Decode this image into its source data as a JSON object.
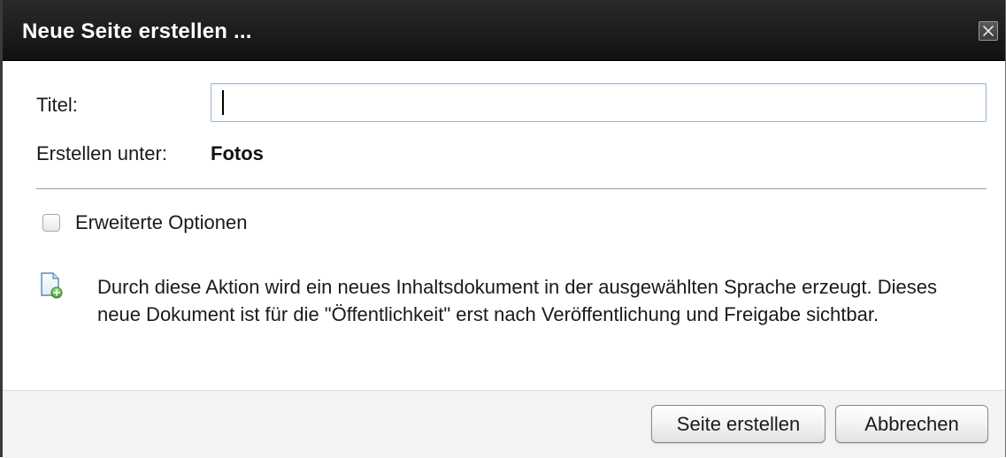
{
  "dialog": {
    "title": "Neue Seite erstellen ...",
    "close_icon": "close-icon"
  },
  "form": {
    "title_label": "Titel:",
    "title_value": "",
    "create_under_label": "Erstellen unter:",
    "create_under_value": "Fotos",
    "advanced_options_label": "Erweiterte Optionen",
    "advanced_options_checked": false
  },
  "info": {
    "icon": "new-document-icon",
    "text": "Durch diese Aktion wird ein neues Inhaltsdokument in der ausgewählten Sprache erzeugt. Dieses neue Dokument ist für die \"Öffentlichkeit\" erst nach Veröffentlichung und Freigabe sichtbar."
  },
  "buttons": {
    "create_label": "Seite erstellen",
    "cancel_label": "Abbrechen"
  },
  "colors": {
    "titlebar": "#1f1f1f",
    "input_border": "#9cb7d1",
    "footer": "#f3f3f3"
  }
}
